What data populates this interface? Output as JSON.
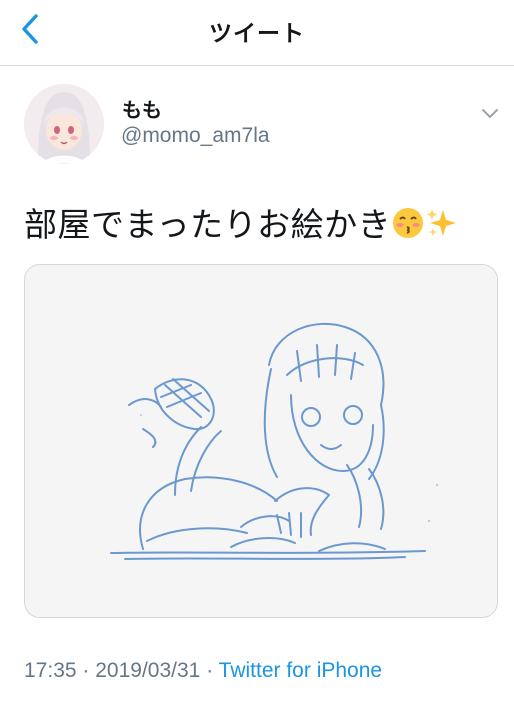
{
  "header": {
    "title": "ツイート",
    "back_icon": "chevron-left-icon",
    "accent_color": "#1b95e0"
  },
  "author": {
    "name": "もも",
    "handle": "@momo_am7la"
  },
  "tweet": {
    "text": "部屋でまったりお絵かき",
    "emojis": [
      "kissing-face-icon",
      "sparkles-icon"
    ],
    "media": {
      "description": "blue pencil sketch illustration"
    }
  },
  "meta": {
    "time": "17:35",
    "separator": "·",
    "date": "2019/03/31",
    "source": "Twitter for iPhone"
  }
}
